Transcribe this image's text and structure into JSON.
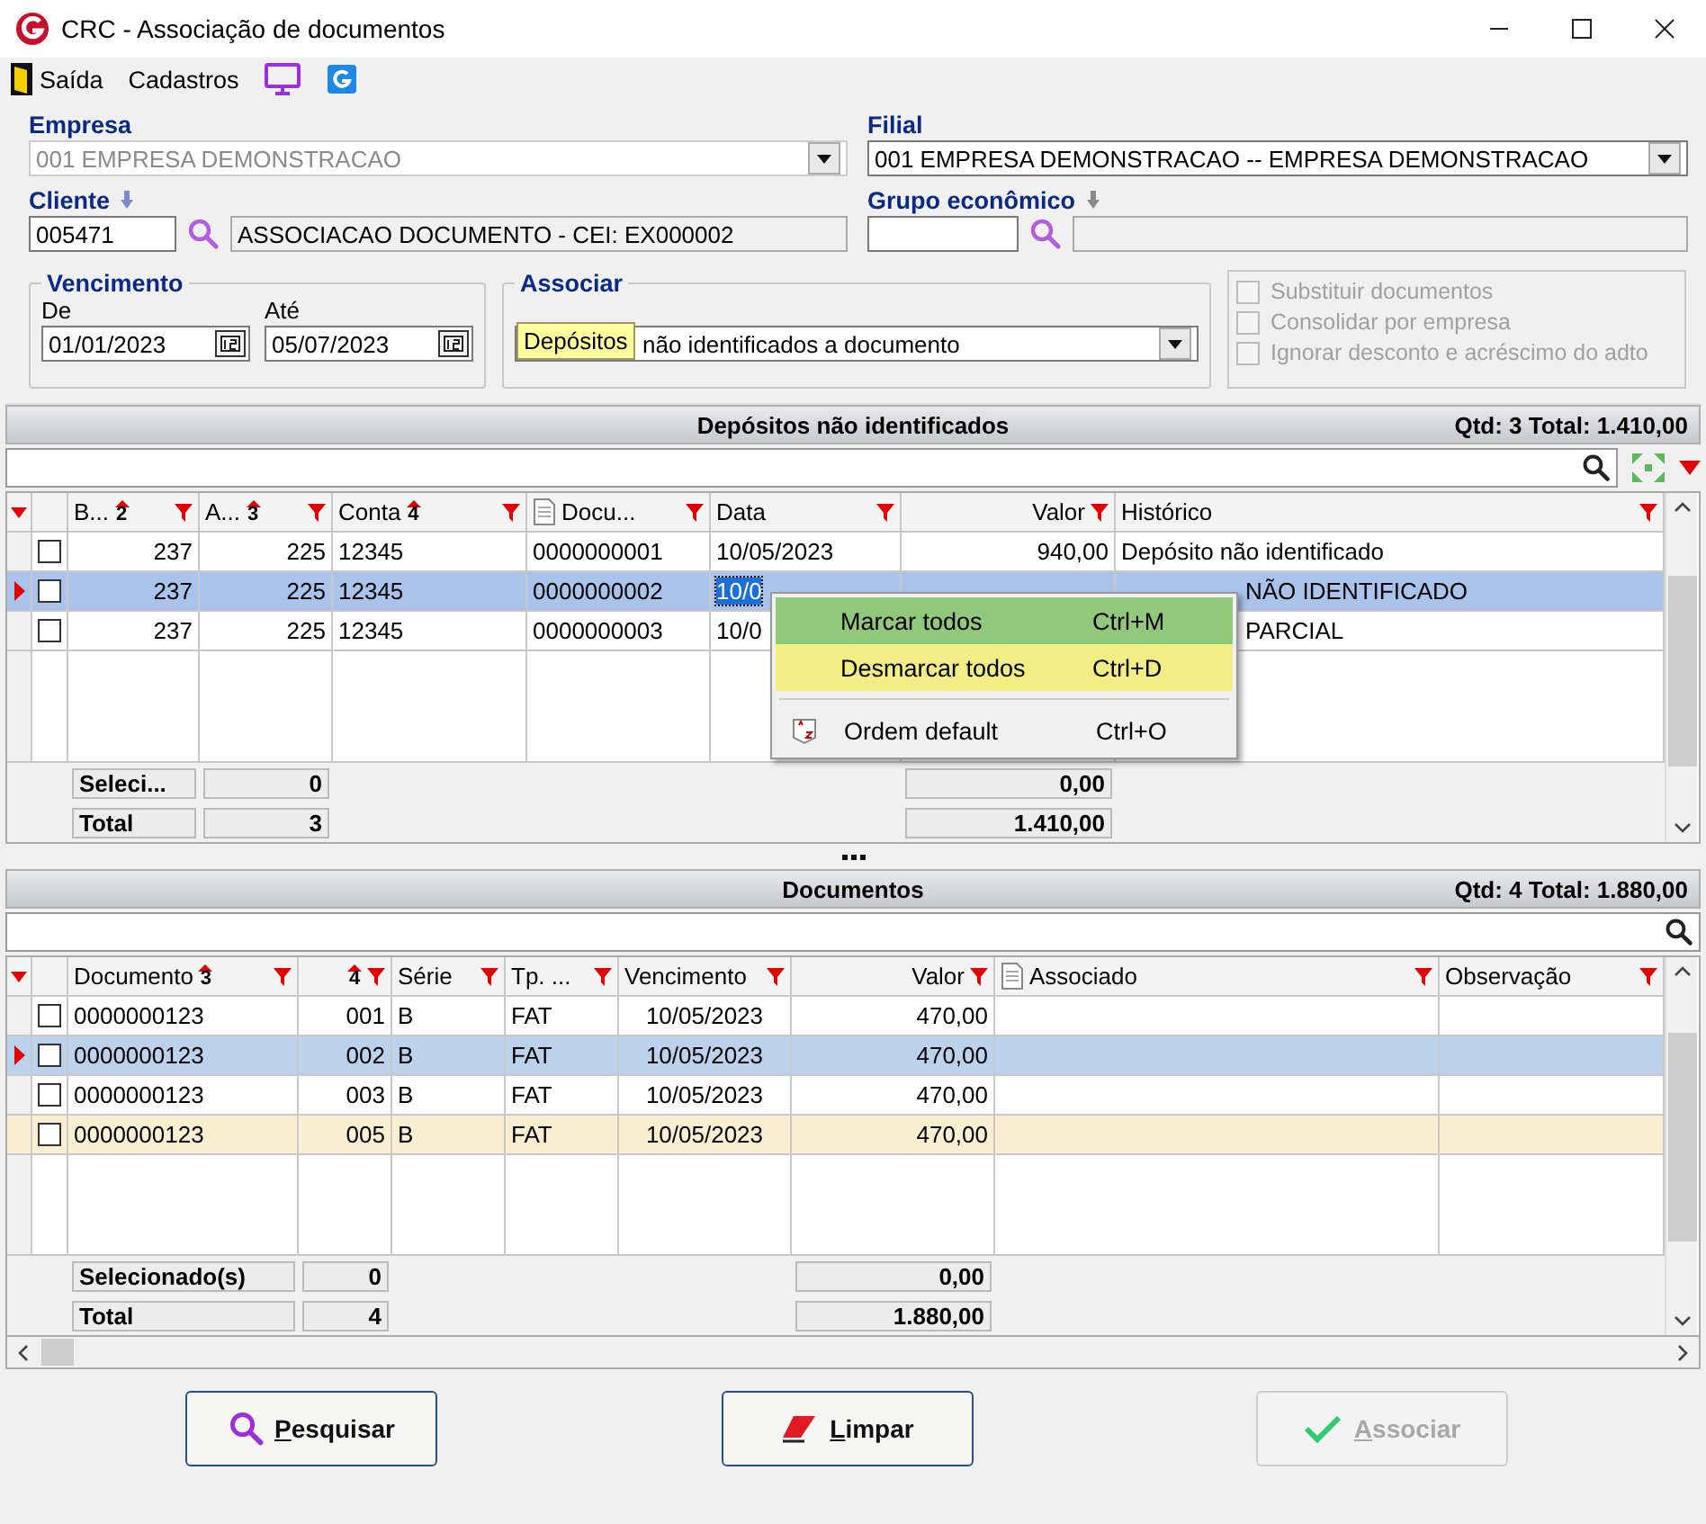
{
  "window": {
    "title": "CRC - Associação de documentos"
  },
  "toolbar": [
    {
      "kind": "exit",
      "label": "Saída"
    },
    {
      "kind": "text",
      "label": "Cadastros"
    },
    {
      "kind": "monitor"
    },
    {
      "kind": "app"
    }
  ],
  "form": {
    "empresa": {
      "label": "Empresa",
      "value": "001 EMPRESA DEMONSTRACAO",
      "disabled": true
    },
    "filial": {
      "label": "Filial",
      "value": "001 EMPRESA DEMONSTRACAO -- EMPRESA DEMONSTRACAO",
      "disabled": false
    },
    "cliente": {
      "label": "Cliente",
      "code": "005471",
      "name": "ASSOCIACAO DOCUMENTO - CEI: EX000002"
    },
    "grupo": {
      "label": "Grupo econômico"
    },
    "vencimento": {
      "legend": "Vencimento",
      "de_label": "De",
      "de": "01/01/2023",
      "ate_label": "Até",
      "ate": "05/07/2023"
    },
    "associar": {
      "legend": "Associar",
      "value": "não identificados a documento",
      "tooltip": "Depósitos"
    },
    "options": [
      {
        "label": "Substituir documentos",
        "checked": false,
        "disabled": true
      },
      {
        "label": "Consolidar por empresa",
        "checked": false,
        "disabled": true
      },
      {
        "label": "Ignorar desconto e acréscimo do adto",
        "checked": false,
        "disabled": true
      }
    ]
  },
  "grids": [
    {
      "title": "Depósitos não identificados",
      "summary": "Qtd: 3 Total: 1.410,00",
      "tools": [
        {
          "kind": "expand"
        },
        {
          "kind": "dropdown"
        }
      ],
      "columns": [
        {
          "label": "B...",
          "sort": "2"
        },
        {
          "label": "A...",
          "sort": "3"
        },
        {
          "label": "Conta",
          "sort": "4"
        },
        {
          "label": "Docu...",
          "kind": "doc"
        },
        {
          "label": "Data"
        },
        {
          "label": "Valor"
        },
        {
          "label": "Histórico"
        }
      ],
      "rows": [
        {
          "selected": false,
          "checked": false,
          "tinted": false,
          "cells": [
            {
              "text": "237"
            },
            {
              "text": "225"
            },
            {
              "text": "12345"
            },
            {
              "text": "0000000001"
            },
            {
              "text": "10/05/2023"
            },
            {
              "text": "940,00"
            },
            {
              "text": "Depósito não identificado"
            }
          ]
        },
        {
          "selected": true,
          "checked": false,
          "tinted": false,
          "cells": [
            {
              "text": "237"
            },
            {
              "text": "225"
            },
            {
              "text": "12345"
            },
            {
              "text": "0000000002"
            },
            {
              "text": "10/0",
              "focused": true
            },
            {},
            {
              "text": "NÃO IDENTIFICADO",
              "clipped": true
            }
          ]
        },
        {
          "selected": false,
          "checked": false,
          "tinted": false,
          "cells": [
            {
              "text": "237"
            },
            {
              "text": "225"
            },
            {
              "text": "12345"
            },
            {
              "text": "0000000003"
            },
            {
              "text": "10/0"
            },
            {},
            {
              "text": "PARCIAL",
              "clipped": true
            }
          ]
        }
      ],
      "footer": [
        {
          "label": "Seleci...",
          "count": "0",
          "value": "0,00"
        },
        {
          "label": "Total",
          "count": "3",
          "value": "1.410,00"
        }
      ],
      "context_menu": [
        {
          "label": "Marcar todos",
          "shortcut": "Ctrl+M",
          "color": "#92c87c"
        },
        {
          "label": "Desmarcar todos",
          "shortcut": "Ctrl+D",
          "color": "#f0ee84"
        },
        {
          "label": "Ordem default",
          "shortcut": "Ctrl+O",
          "kind": "sort"
        }
      ]
    },
    {
      "title": "Documentos",
      "summary": "Qtd: 4 Total: 1.880,00",
      "columns": [
        {
          "label": "Documento",
          "sort": "3"
        },
        {
          "sort": "4"
        },
        {
          "label": "Série"
        },
        {
          "label": "Tp. ..."
        },
        {
          "label": "Vencimento"
        },
        {
          "label": "Valor"
        },
        {
          "label": "Associado",
          "kind": "doc"
        },
        {
          "label": "Observação"
        }
      ],
      "rows": [
        {
          "selected": false,
          "checked": false,
          "tinted": false,
          "cells": [
            {
              "text": "0000000123"
            },
            {
              "text": "001"
            },
            {
              "text": "B"
            },
            {
              "text": "FAT"
            },
            {
              "text": "10/05/2023"
            },
            {
              "text": "470,00"
            }
          ]
        },
        {
          "selected": true,
          "checked": false,
          "tinted": false,
          "cells": [
            {
              "text": "0000000123"
            },
            {
              "text": "002"
            },
            {
              "text": "B"
            },
            {
              "text": "FAT"
            },
            {
              "text": "10/05/2023"
            },
            {
              "text": "470,00"
            }
          ]
        },
        {
          "selected": false,
          "checked": false,
          "tinted": false,
          "cells": [
            {
              "text": "0000000123"
            },
            {
              "text": "003"
            },
            {
              "text": "B"
            },
            {
              "text": "FAT"
            },
            {
              "text": "10/05/2023"
            },
            {
              "text": "470,00"
            }
          ]
        },
        {
          "selected": false,
          "checked": false,
          "tinted": true,
          "cells": [
            {
              "text": "0000000123"
            },
            {
              "text": "005"
            },
            {
              "text": "B"
            },
            {
              "text": "FAT"
            },
            {
              "text": "10/05/2023"
            },
            {
              "text": "470,00"
            }
          ]
        }
      ],
      "footer": [
        {
          "label": "Selecionado(s)",
          "count": "0",
          "value": "0,00"
        },
        {
          "label": "Total",
          "count": "4",
          "value": "1.880,00"
        }
      ]
    }
  ],
  "buttons": [
    {
      "label": "Pesquisar",
      "kind": "search",
      "disabled": false
    },
    {
      "label": "Limpar",
      "kind": "eraser",
      "disabled": false
    },
    {
      "label": "Associar",
      "kind": "check",
      "disabled": true
    }
  ]
}
